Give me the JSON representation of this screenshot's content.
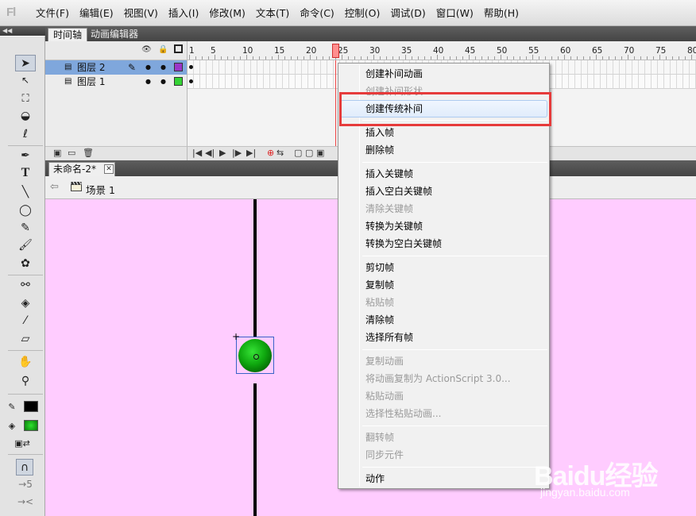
{
  "app": {
    "logo_text": "Fl"
  },
  "menubar": {
    "items": [
      "文件(F)",
      "编辑(E)",
      "视图(V)",
      "插入(I)",
      "修改(M)",
      "文本(T)",
      "命令(C)",
      "控制(O)",
      "调试(D)",
      "窗口(W)",
      "帮助(H)"
    ]
  },
  "timeline": {
    "tabs": [
      "时间轴",
      "动画编辑器"
    ],
    "ruler_labels": [
      "1",
      "5",
      "10",
      "15",
      "20",
      "25",
      "30",
      "35",
      "40",
      "45",
      "50",
      "55",
      "60",
      "65",
      "70",
      "75",
      "80"
    ],
    "current_frame": 24,
    "layers": [
      {
        "name": "图层 2",
        "selected": true,
        "color": "#9b35c9"
      },
      {
        "name": "图层 1",
        "selected": false,
        "color": "#35d235"
      }
    ]
  },
  "document": {
    "tab_title": "未命名-2*",
    "close_symbol": "✕",
    "scene_label": "场景 1"
  },
  "stage": {
    "background": "#ffccff",
    "ball_color": "#0fa80f"
  },
  "tools": {
    "stroke_color": "#000000",
    "fill_color": "#0fa80f"
  },
  "context_menu": {
    "items": [
      {
        "label": "创建补间动画",
        "enabled": true
      },
      {
        "label": "创建补间形状",
        "enabled": false
      },
      {
        "label": "创建传统补间",
        "enabled": true,
        "hover": true
      },
      {
        "label": "插入帧",
        "enabled": true
      },
      {
        "label": "删除帧",
        "enabled": true
      },
      {
        "label": "插入关键帧",
        "enabled": true
      },
      {
        "label": "插入空白关键帧",
        "enabled": true
      },
      {
        "label": "清除关键帧",
        "enabled": false
      },
      {
        "label": "转换为关键帧",
        "enabled": true
      },
      {
        "label": "转换为空白关键帧",
        "enabled": true
      },
      {
        "label": "剪切帧",
        "enabled": true
      },
      {
        "label": "复制帧",
        "enabled": true
      },
      {
        "label": "粘贴帧",
        "enabled": false
      },
      {
        "label": "清除帧",
        "enabled": true
      },
      {
        "label": "选择所有帧",
        "enabled": true
      },
      {
        "label": "复制动画",
        "enabled": false
      },
      {
        "label": "将动画复制为 ActionScript 3.0...",
        "enabled": false
      },
      {
        "label": "粘贴动画",
        "enabled": false
      },
      {
        "label": "选择性粘贴动画...",
        "enabled": false
      },
      {
        "label": "翻转帧",
        "enabled": false
      },
      {
        "label": "同步元件",
        "enabled": false
      },
      {
        "label": "动作",
        "enabled": true
      }
    ]
  },
  "watermark": {
    "logo": "Baidu经验",
    "url": "jingyan.baidu.com"
  }
}
